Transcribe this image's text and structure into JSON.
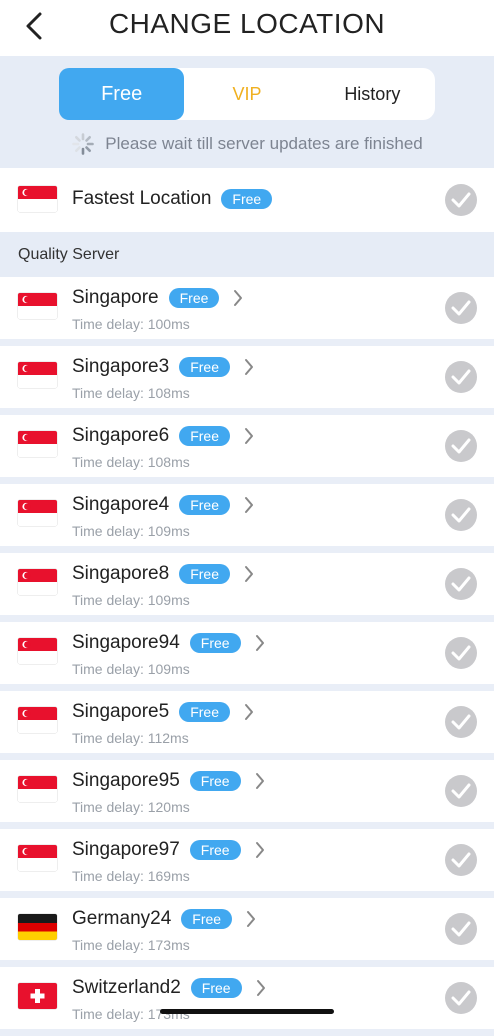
{
  "header": {
    "title": "CHANGE LOCATION"
  },
  "tabs": [
    {
      "label": "Free",
      "active": true
    },
    {
      "label": "VIP",
      "active": false
    },
    {
      "label": "History",
      "active": false
    }
  ],
  "notice": "Please wait till server updates are finished",
  "fastest": {
    "name": "Fastest Location",
    "badge": "Free",
    "flag": "sg"
  },
  "section_title": "Quality Server",
  "servers": [
    {
      "name": "Singapore",
      "badge": "Free",
      "delay": "Time delay: 100ms",
      "flag": "sg"
    },
    {
      "name": "Singapore3",
      "badge": "Free",
      "delay": "Time delay: 108ms",
      "flag": "sg"
    },
    {
      "name": "Singapore6",
      "badge": "Free",
      "delay": "Time delay: 108ms",
      "flag": "sg"
    },
    {
      "name": "Singapore4",
      "badge": "Free",
      "delay": "Time delay: 109ms",
      "flag": "sg"
    },
    {
      "name": "Singapore8",
      "badge": "Free",
      "delay": "Time delay: 109ms",
      "flag": "sg"
    },
    {
      "name": "Singapore94",
      "badge": "Free",
      "delay": "Time delay: 109ms",
      "flag": "sg"
    },
    {
      "name": "Singapore5",
      "badge": "Free",
      "delay": "Time delay: 112ms",
      "flag": "sg"
    },
    {
      "name": "Singapore95",
      "badge": "Free",
      "delay": "Time delay: 120ms",
      "flag": "sg"
    },
    {
      "name": "Singapore97",
      "badge": "Free",
      "delay": "Time delay: 169ms",
      "flag": "sg"
    },
    {
      "name": "Germany24",
      "badge": "Free",
      "delay": "Time delay: 173ms",
      "flag": "de"
    },
    {
      "name": "Switzerland2",
      "badge": "Free",
      "delay": "Time delay: 173ms",
      "flag": "ch"
    }
  ],
  "colors": {
    "accent": "#41a8f0",
    "vip": "#f0b020",
    "check": "#c9c9cc"
  }
}
